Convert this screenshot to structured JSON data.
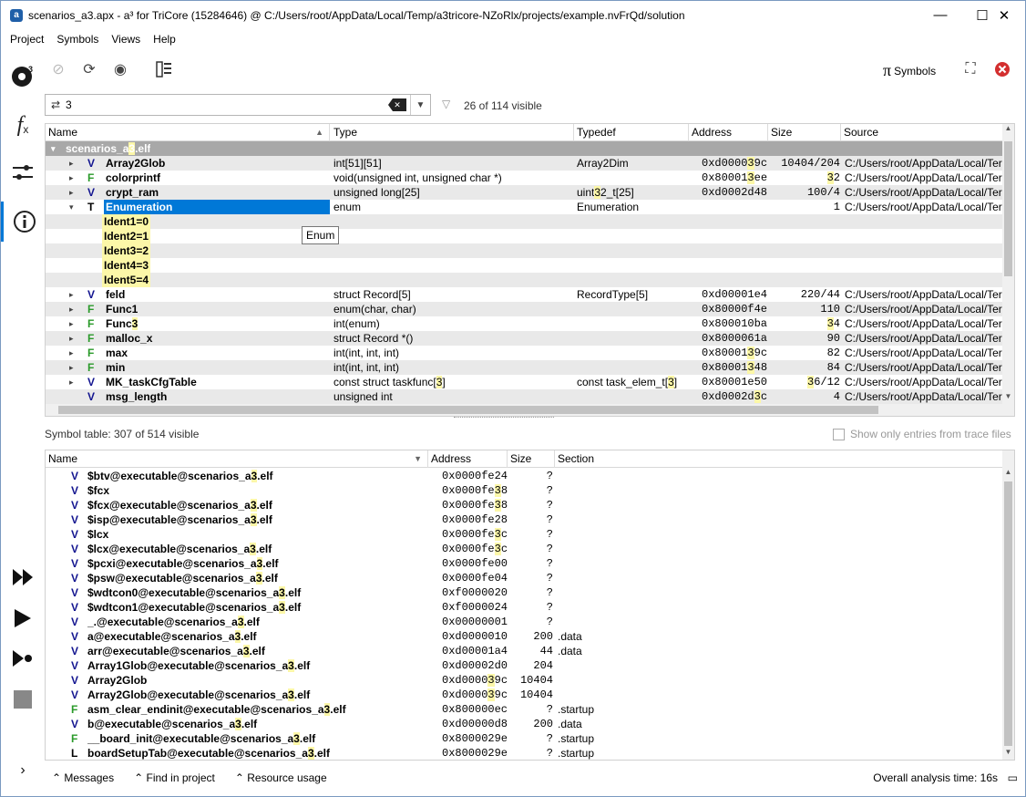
{
  "window": {
    "title": "scenarios_a3.apx - a³ for TriCore (15284646) @ C:/Users/root/AppData/Local/Temp/a3tricore-NZoRlx/projects/example.nvFrQd/solution",
    "minimize": "—",
    "maximize": "☐",
    "close": "✕"
  },
  "menu": [
    "Project",
    "Symbols",
    "Views",
    "Help"
  ],
  "toolbar": {
    "symbols_label": "Symbols",
    "pi": "π"
  },
  "filter": {
    "value": "3",
    "visible_info": "26 of 114 visible"
  },
  "columns": [
    "Name",
    "Type",
    "Typedef",
    "Address",
    "Size",
    "Source"
  ],
  "group_label": "scenarios_a3.elf",
  "tooltip": "Enum",
  "rows": [
    {
      "arrow": "▸",
      "kind": "V",
      "name": "Array2Glob",
      "type": "int[51][51]",
      "typedef": "Array2Dim",
      "address": "0xd000039c",
      "size": "10404/204",
      "source": "C:/Users/root/AppData/Local/Ter"
    },
    {
      "arrow": "▸",
      "kind": "F",
      "name": "colorprintf",
      "type": "void(unsigned int, unsigned char *)",
      "typedef": "",
      "address": "0x800013ee",
      "size": "32",
      "source": "C:/Users/root/AppData/Local/Ter"
    },
    {
      "arrow": "▸",
      "kind": "V",
      "name": "crypt_ram",
      "type": "unsigned long[25]",
      "typedef": "uint32_t[25]",
      "address": "0xd0002d48",
      "size": "100/4",
      "source": "C:/Users/root/AppData/Local/Ter"
    },
    {
      "arrow": "▾",
      "kind": "T",
      "name": "Enumeration",
      "type": "enum",
      "typedef": "Enumeration",
      "address": "",
      "size": "1",
      "source": "C:/Users/root/AppData/Local/Ter"
    },
    {
      "arrow": "",
      "kind": "",
      "name": "Ident1=0",
      "type": "",
      "typedef": "",
      "address": "",
      "size": "",
      "source": "",
      "child": true
    },
    {
      "arrow": "",
      "kind": "",
      "name": "Ident2=1",
      "type": "",
      "typedef": "",
      "address": "",
      "size": "",
      "source": "",
      "child": true
    },
    {
      "arrow": "",
      "kind": "",
      "name": "Ident3=2",
      "type": "",
      "typedef": "",
      "address": "",
      "size": "",
      "source": "",
      "child": true
    },
    {
      "arrow": "",
      "kind": "",
      "name": "Ident4=3",
      "type": "",
      "typedef": "",
      "address": "",
      "size": "",
      "source": "",
      "child": true
    },
    {
      "arrow": "",
      "kind": "",
      "name": "Ident5=4",
      "type": "",
      "typedef": "",
      "address": "",
      "size": "",
      "source": "",
      "child": true
    },
    {
      "arrow": "▸",
      "kind": "V",
      "name": "feld",
      "type": "struct Record[5]",
      "typedef": "RecordType[5]",
      "address": "0xd00001e4",
      "size": "220/44",
      "source": "C:/Users/root/AppData/Local/Ter"
    },
    {
      "arrow": "▸",
      "kind": "F",
      "name": "Func1",
      "type": "enum(char, char)",
      "typedef": "",
      "address": "0x80000f4e",
      "size": "110",
      "source": "C:/Users/root/AppData/Local/Ter"
    },
    {
      "arrow": "▸",
      "kind": "F",
      "name": "Func3",
      "type": "int(enum)",
      "typedef": "",
      "address": "0x800010ba",
      "size": "34",
      "source": "C:/Users/root/AppData/Local/Ter"
    },
    {
      "arrow": "▸",
      "kind": "F",
      "name": "malloc_x",
      "type": "struct Record *()",
      "typedef": "",
      "address": "0x8000061a",
      "size": "90",
      "source": "C:/Users/root/AppData/Local/Ter"
    },
    {
      "arrow": "▸",
      "kind": "F",
      "name": "max",
      "type": "int(int, int, int)",
      "typedef": "",
      "address": "0x8000139c",
      "size": "82",
      "source": "C:/Users/root/AppData/Local/Ter"
    },
    {
      "arrow": "▸",
      "kind": "F",
      "name": "min",
      "type": "int(int, int, int)",
      "typedef": "",
      "address": "0x80001348",
      "size": "84",
      "source": "C:/Users/root/AppData/Local/Ter"
    },
    {
      "arrow": "▸",
      "kind": "V",
      "name": "MK_taskCfgTable",
      "type": "const struct taskfunc[3]",
      "typedef": "const task_elem_t[3]",
      "address": "0x80001e50",
      "size": "36/12",
      "source": "C:/Users/root/AppData/Local/Ter"
    },
    {
      "arrow": "",
      "kind": "V",
      "name": "msg_length",
      "type": "unsigned int",
      "typedef": "",
      "address": "0xd0002d3c",
      "size": "4",
      "source": "C:/Users/root/AppData/Local/Ter"
    }
  ],
  "symtable": {
    "label": "Symbol table: 307 of 514 visible",
    "trace_checkbox": "Show only entries from trace files",
    "columns": [
      "Name",
      "Address",
      "Size",
      "Section"
    ],
    "rows": [
      {
        "kind": "V",
        "name": "$btv@executable@scenarios_a3.elf",
        "address": "0x0000fe24",
        "size": "?",
        "section": ""
      },
      {
        "kind": "V",
        "name": "$fcx",
        "address": "0x0000fe38",
        "size": "?",
        "section": ""
      },
      {
        "kind": "V",
        "name": "$fcx@executable@scenarios_a3.elf",
        "address": "0x0000fe38",
        "size": "?",
        "section": ""
      },
      {
        "kind": "V",
        "name": "$isp@executable@scenarios_a3.elf",
        "address": "0x0000fe28",
        "size": "?",
        "section": ""
      },
      {
        "kind": "V",
        "name": "$lcx",
        "address": "0x0000fe3c",
        "size": "?",
        "section": ""
      },
      {
        "kind": "V",
        "name": "$lcx@executable@scenarios_a3.elf",
        "address": "0x0000fe3c",
        "size": "?",
        "section": ""
      },
      {
        "kind": "V",
        "name": "$pcxi@executable@scenarios_a3.elf",
        "address": "0x0000fe00",
        "size": "?",
        "section": ""
      },
      {
        "kind": "V",
        "name": "$psw@executable@scenarios_a3.elf",
        "address": "0x0000fe04",
        "size": "?",
        "section": ""
      },
      {
        "kind": "V",
        "name": "$wdtcon0@executable@scenarios_a3.elf",
        "address": "0xf0000020",
        "size": "?",
        "section": ""
      },
      {
        "kind": "V",
        "name": "$wdtcon1@executable@scenarios_a3.elf",
        "address": "0xf0000024",
        "size": "?",
        "section": ""
      },
      {
        "kind": "V",
        "name": "_.@executable@scenarios_a3.elf",
        "address": "0x00000001",
        "size": "?",
        "section": ""
      },
      {
        "kind": "V",
        "name": "a@executable@scenarios_a3.elf",
        "address": "0xd0000010",
        "size": "200",
        "section": ".data"
      },
      {
        "kind": "V",
        "name": "arr@executable@scenarios_a3.elf",
        "address": "0xd00001a4",
        "size": "44",
        "section": ".data"
      },
      {
        "kind": "V",
        "name": "Array1Glob@executable@scenarios_a3.elf",
        "address": "0xd00002d0",
        "size": "204",
        "section": ""
      },
      {
        "kind": "V",
        "name": "Array2Glob",
        "address": "0xd000039c",
        "size": "10404",
        "section": ""
      },
      {
        "kind": "V",
        "name": "Array2Glob@executable@scenarios_a3.elf",
        "address": "0xd000039c",
        "size": "10404",
        "section": ""
      },
      {
        "kind": "F",
        "name": "asm_clear_endinit@executable@scenarios_a3.elf",
        "address": "0x800000ec",
        "size": "?",
        "section": ".startup"
      },
      {
        "kind": "V",
        "name": "b@executable@scenarios_a3.elf",
        "address": "0xd00000d8",
        "size": "200",
        "section": ".data"
      },
      {
        "kind": "F",
        "name": "__board_init@executable@scenarios_a3.elf",
        "address": "0x8000029e",
        "size": "?",
        "section": ".startup"
      },
      {
        "kind": "L",
        "name": "boardSetupTab@executable@scenarios_a3.elf",
        "address": "0x8000029e",
        "size": "?",
        "section": ".startup"
      }
    ]
  },
  "statusbar": {
    "messages": "Messages",
    "find": "Find in project",
    "resource": "Resource usage",
    "time": "Overall analysis time: 16s"
  },
  "leftbar": {
    "fx": "f",
    "fx_sub": "x"
  }
}
